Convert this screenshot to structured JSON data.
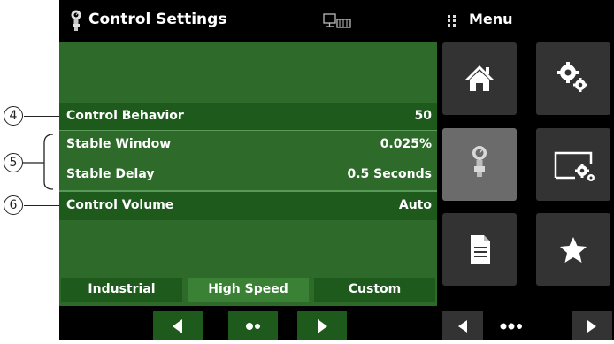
{
  "header": {
    "title": "Control Settings",
    "menu_label": "Menu"
  },
  "rows": [
    {
      "label": "Control Behavior",
      "value": "50"
    },
    {
      "label": "Stable Window",
      "value": "0.025%"
    },
    {
      "label": "Stable Delay",
      "value": "0.5 Seconds"
    },
    {
      "label": "Control Volume",
      "value": "Auto"
    }
  ],
  "modes": [
    "Industrial",
    "High Speed",
    "Custom"
  ],
  "selected_mode": "High Speed",
  "callouts": [
    "4",
    "5",
    "6"
  ],
  "menu_tiles": [
    "home-icon",
    "gears-icon",
    "sensor-icon",
    "display-settings-icon",
    "document-icon",
    "star-icon"
  ],
  "colors": {
    "panel_green": "#2e6b2b",
    "row_dark_green": "#1f5a1d",
    "selected_mode": "#3a8035",
    "tile_gray": "#333333",
    "tile_active": "#6b6b6b"
  }
}
